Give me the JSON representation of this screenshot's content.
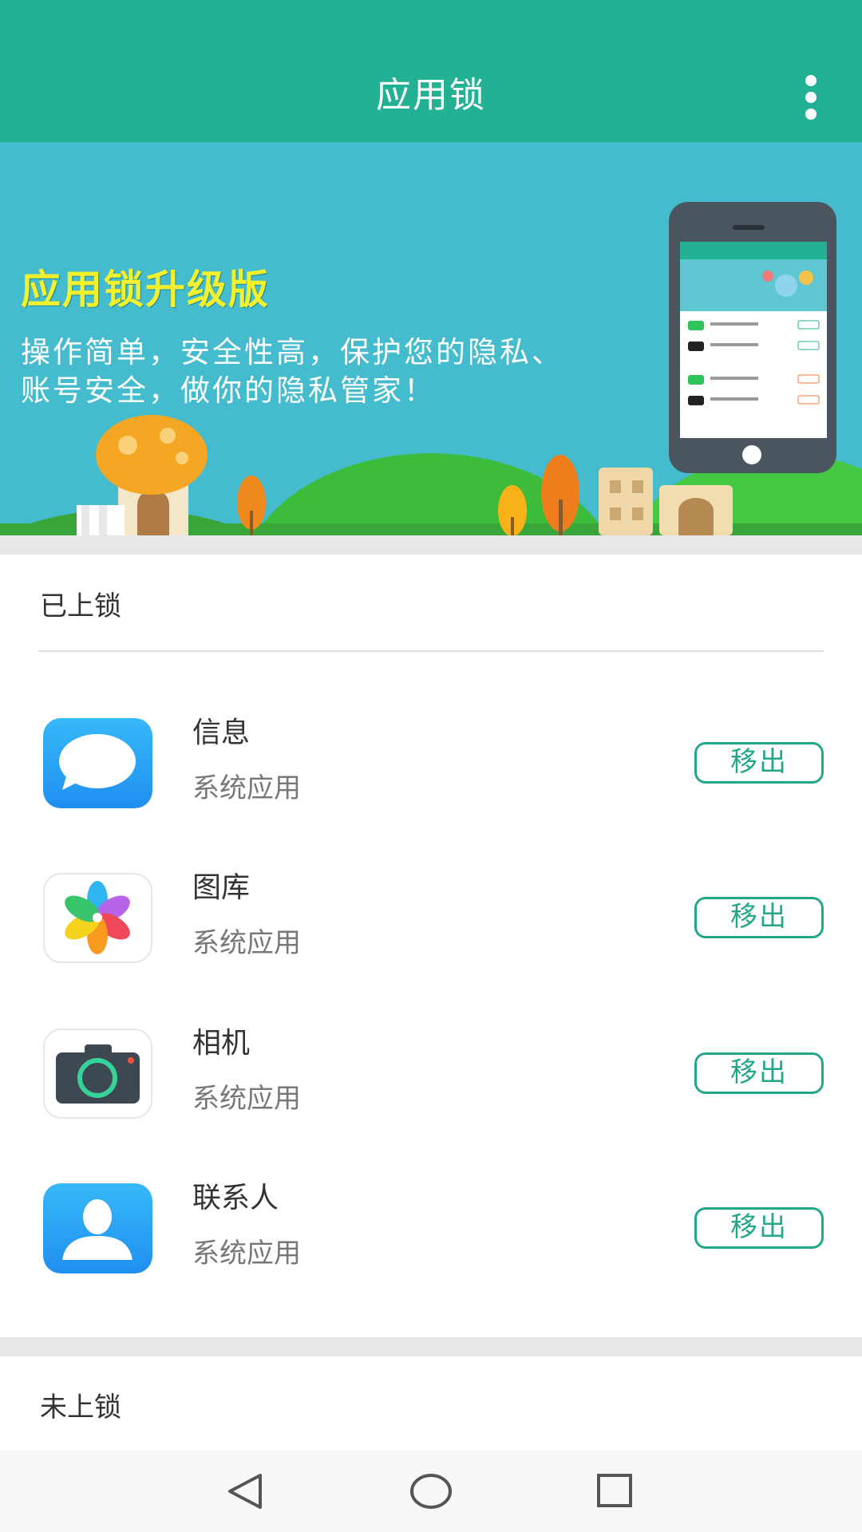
{
  "appbar": {
    "title": "应用锁",
    "menu_icon": "more-vert-icon"
  },
  "banner": {
    "headline": "应用锁升级版",
    "description": "操作简单，安全性高，保护您的隐私、账号安全，做你的隐私管家！",
    "colors": {
      "sky": "#44bccd",
      "headline": "#f4f12c"
    }
  },
  "locked": {
    "title": "已上锁",
    "apps": [
      {
        "name": "信息",
        "type": "系统应用",
        "action": "移出",
        "icon": "messages-icon"
      },
      {
        "name": "图库",
        "type": "系统应用",
        "action": "移出",
        "icon": "gallery-icon"
      },
      {
        "name": "相机",
        "type": "系统应用",
        "action": "移出",
        "icon": "camera-icon"
      },
      {
        "name": "联系人",
        "type": "系统应用",
        "action": "移出",
        "icon": "contacts-icon"
      }
    ]
  },
  "unlocked": {
    "title": "未上锁"
  },
  "navbar": {
    "back": "back-icon",
    "home": "home-icon",
    "recents": "recents-icon"
  },
  "colors": {
    "accent": "#22b293",
    "button": "#22a78b"
  }
}
